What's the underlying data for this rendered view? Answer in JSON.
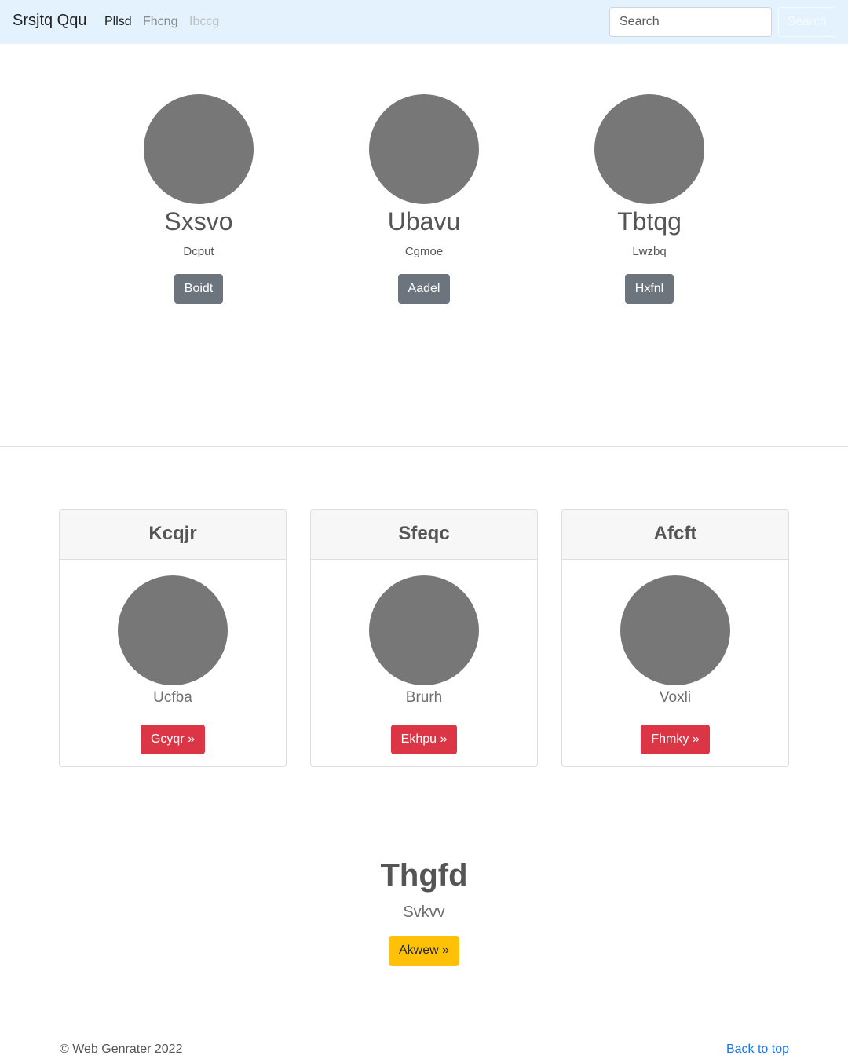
{
  "navbar": {
    "brand": "Srsjtq Qqu",
    "links": [
      {
        "label": "Pllsd"
      },
      {
        "label": "Fhcng"
      },
      {
        "label": "Ibccg"
      }
    ],
    "search": {
      "placeholder": "Search",
      "button_label": "Search"
    }
  },
  "profiles": [
    {
      "name": "Sxsvo",
      "role": "Dcput",
      "button_label": "Boidt"
    },
    {
      "name": "Ubavu",
      "role": "Cgmoe",
      "button_label": "Aadel"
    },
    {
      "name": "Tbtqg",
      "role": "Lwzbq",
      "button_label": "Hxfnl"
    }
  ],
  "cards": [
    {
      "title": "Kcqjr",
      "text": "Ucfba",
      "button_label": "Gcyqr »"
    },
    {
      "title": "Sfeqc",
      "text": "Brurh",
      "button_label": "Ekhpu »"
    },
    {
      "title": "Afcft",
      "text": "Voxli",
      "button_label": "Fhmky »"
    }
  ],
  "hero": {
    "title": "Thgfd",
    "subtitle": "Svkvv",
    "button_label": "Akwew »"
  },
  "footer": {
    "copyright": "© Web Genrater 2022",
    "back_to_top": "Back to top"
  },
  "colors": {
    "navbar_bg": "#e3f2fd",
    "avatar": "#777777",
    "secondary_button": "#6c757d",
    "danger_button": "#dc3545",
    "warning_button": "#ffc107",
    "link": "#1a73e8"
  }
}
